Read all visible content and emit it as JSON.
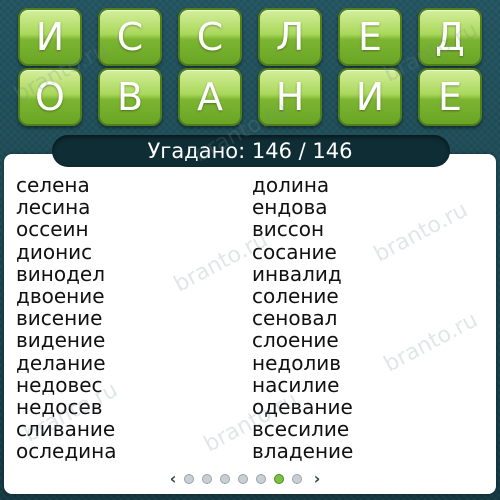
{
  "letter_tiles": {
    "row1": [
      "И",
      "С",
      "С",
      "Л",
      "Е",
      "Д"
    ],
    "row2": [
      "О",
      "В",
      "А",
      "Н",
      "И",
      "Е"
    ]
  },
  "counter": {
    "text": "Угадано: 146 / 146"
  },
  "words": {
    "left": [
      "селена",
      "лесина",
      "оссеин",
      "дионис",
      "винодел",
      "двоение",
      "висение",
      "видение",
      "делание",
      "недовес",
      "недосев",
      "сливание",
      "оследина"
    ],
    "right": [
      "долина",
      "ендова",
      "виссон",
      "сосание",
      "инвалид",
      "соление",
      "сеновал",
      "слоение",
      "недолив",
      "насилие",
      "одевание",
      "всесилие",
      "владение"
    ]
  },
  "pager": {
    "prev_icon": "chevron-left-icon",
    "next_icon": "chevron-right-icon",
    "prev_glyph": "‹",
    "next_glyph": "›",
    "dot_count": 7,
    "active_index": 5
  },
  "watermark": "branto.ru",
  "colors": {
    "background": "#1c4852",
    "tile_green": "#7cb531",
    "panel": "#ffffff",
    "active_dot": "#7cc043"
  }
}
